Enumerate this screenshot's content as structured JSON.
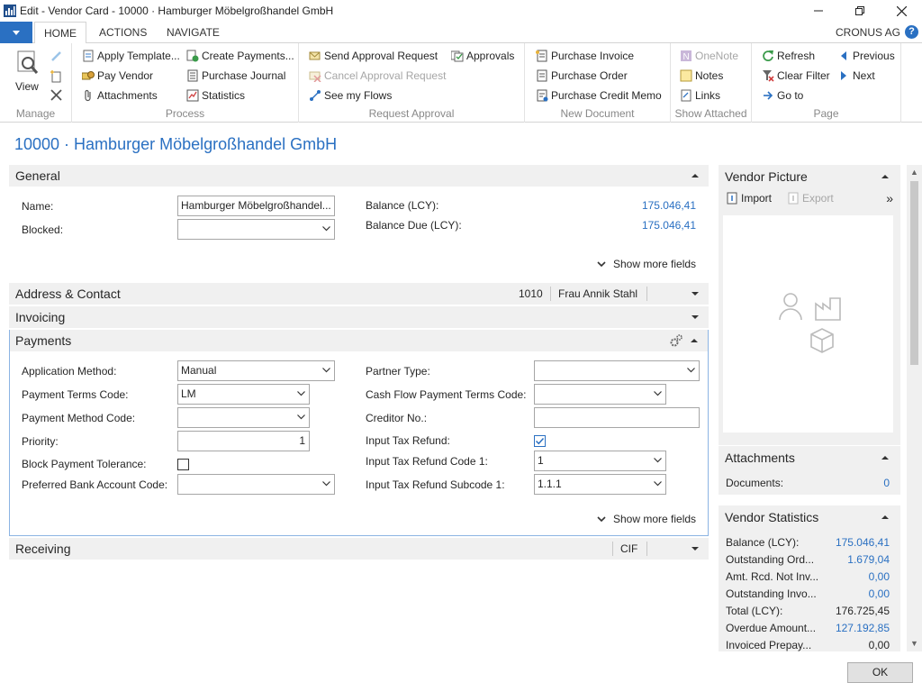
{
  "window": {
    "title": "Edit - Vendor Card - 10000 · Hamburger Möbelgroßhandel GmbH",
    "minimize": "—",
    "maximize": "⧉",
    "close": "✕"
  },
  "ribbon_tabs": {
    "home": "HOME",
    "actions": "ACTIONS",
    "navigate": "NAVIGATE",
    "company": "CRONUS AG",
    "help": "?"
  },
  "ribbon": {
    "manage": {
      "label": "Manage",
      "view": "View"
    },
    "process": {
      "label": "Process",
      "apply_template": "Apply Template...",
      "pay_vendor": "Pay Vendor",
      "attachments": "Attachments",
      "create_payments": "Create Payments...",
      "purchase_journal": "Purchase Journal",
      "statistics": "Statistics"
    },
    "request_approval": {
      "label": "Request Approval",
      "send": "Send Approval Request",
      "cancel": "Cancel Approval Request",
      "flows": "See my Flows",
      "approvals": "Approvals"
    },
    "new_document": {
      "label": "New Document",
      "invoice": "Purchase Invoice",
      "order": "Purchase Order",
      "credit_memo": "Purchase Credit Memo"
    },
    "show_attached": {
      "label": "Show Attached",
      "onenote": "OneNote",
      "notes": "Notes",
      "links": "Links"
    },
    "page": {
      "label": "Page",
      "refresh": "Refresh",
      "clear_filter": "Clear Filter",
      "go_to": "Go to",
      "previous": "Previous",
      "next": "Next"
    }
  },
  "page_title": "10000 · Hamburger Möbelgroßhandel GmbH",
  "general": {
    "title": "General",
    "name_label": "Name:",
    "name_value": "Hamburger Möbelgroßhandel...",
    "blocked_label": "Blocked:",
    "blocked_value": "",
    "balance_label": "Balance (LCY):",
    "balance_value": "175.046,41",
    "balance_due_label": "Balance Due (LCY):",
    "balance_due_value": "175.046,41",
    "show_more": "Show more fields"
  },
  "address_contact": {
    "title": "Address & Contact",
    "promoted_1": "1010",
    "promoted_2": "Frau Annik Stahl"
  },
  "invoicing": {
    "title": "Invoicing"
  },
  "payments": {
    "title": "Payments",
    "application_method_label": "Application Method:",
    "application_method_value": "Manual",
    "payment_terms_label": "Payment Terms Code:",
    "payment_terms_value": "LM",
    "payment_method_label": "Payment Method Code:",
    "payment_method_value": "",
    "priority_label": "Priority:",
    "priority_value": "1",
    "block_tolerance_label": "Block Payment Tolerance:",
    "block_tolerance_checked": false,
    "preferred_bank_label": "Preferred Bank Account Code:",
    "preferred_bank_value": "",
    "partner_type_label": "Partner Type:",
    "partner_type_value": "",
    "cash_flow_label": "Cash Flow Payment Terms Code:",
    "cash_flow_value": "",
    "creditor_no_label": "Creditor No.:",
    "creditor_no_value": "",
    "input_tax_refund_label": "Input Tax Refund:",
    "input_tax_refund_checked": true,
    "input_tax_code_label": "Input Tax Refund Code 1:",
    "input_tax_code_value": "1",
    "input_tax_subcode_label": "Input Tax Refund Subcode 1:",
    "input_tax_subcode_value": "1.1.1",
    "show_more": "Show more fields"
  },
  "receiving": {
    "title": "Receiving",
    "promoted_1": "CIF"
  },
  "vendor_picture": {
    "title": "Vendor Picture",
    "import": "Import",
    "export": "Export",
    "more": "»"
  },
  "attachments_box": {
    "title": "Attachments",
    "documents_label": "Documents:",
    "documents_value": "0"
  },
  "vendor_statistics": {
    "title": "Vendor Statistics",
    "rows": [
      {
        "label": "Balance (LCY):",
        "value": "175.046,41",
        "link": true
      },
      {
        "label": "Outstanding Ord...",
        "value": "1.679,04",
        "link": true
      },
      {
        "label": "Amt. Rcd. Not Inv...",
        "value": "0,00",
        "link": true
      },
      {
        "label": "Outstanding Invo...",
        "value": "0,00",
        "link": true
      },
      {
        "label": "Total (LCY):",
        "value": "176.725,45",
        "link": false
      },
      {
        "label": "Overdue Amount...",
        "value": "127.192,85",
        "link": true
      },
      {
        "label": "Invoiced Prepay...",
        "value": "0,00",
        "link": false
      }
    ]
  },
  "ok_button": "OK",
  "colors": {
    "accent": "#2a70c2",
    "tab_bg": "#f0f0f0",
    "focus_border": "#8cb4e3"
  }
}
